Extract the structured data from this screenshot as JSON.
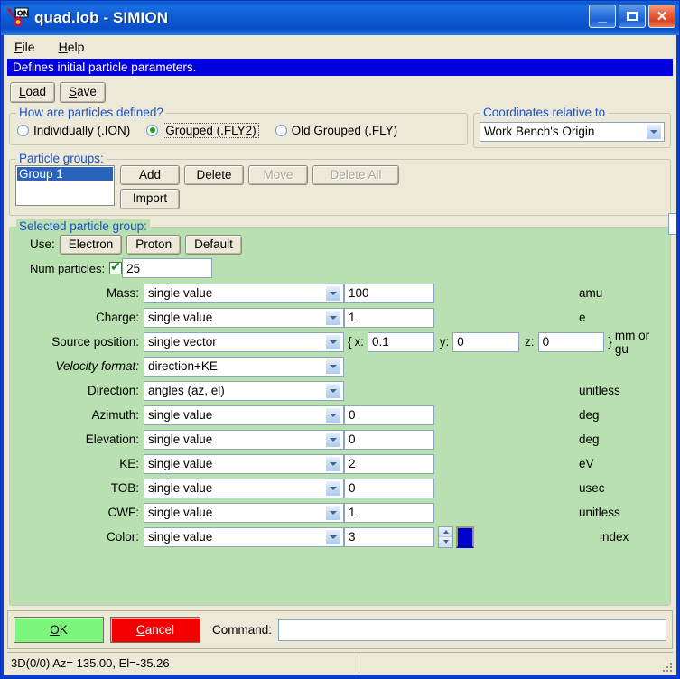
{
  "window": {
    "title": "quad.iob - SIMION",
    "app_icon": "ion-starburst-icon",
    "minimize": "_",
    "maximize": "maximize-icon",
    "close": "✕"
  },
  "menubar": {
    "items": [
      {
        "label": "File",
        "accel": "F"
      },
      {
        "label": "Help",
        "accel": "H"
      }
    ]
  },
  "hint": {
    "text": "Defines initial particle parameters."
  },
  "toolbar": {
    "load_label": "Load",
    "load_accel": "L",
    "save_label": "Save",
    "save_accel": "S"
  },
  "defined_group": {
    "title": "How are particles defined?",
    "options": [
      {
        "label": "Individually (.ION)",
        "selected": false,
        "focused": false
      },
      {
        "label": "Grouped (.FLY2)",
        "selected": true,
        "focused": true
      },
      {
        "label": "Old Grouped (.FLY)",
        "selected": false,
        "focused": false
      }
    ]
  },
  "coords_group": {
    "title": "Coordinates relative to",
    "value": "Work Bench's Origin"
  },
  "particle_groups": {
    "title": "Particle groups:",
    "list": [
      "Group 1"
    ],
    "selected": "Group 1",
    "buttons": [
      {
        "label": "Add",
        "enabled": true
      },
      {
        "label": "Delete",
        "enabled": true
      },
      {
        "label": "Move",
        "enabled": false
      },
      {
        "label": "Delete All",
        "enabled": false
      },
      {
        "label": "Import",
        "enabled": true
      }
    ]
  },
  "selected_group": {
    "title": "Selected particle group:",
    "use_label": "Use:",
    "use_buttons": [
      "Electron",
      "Proton",
      "Default"
    ],
    "num_particles_label": "Num particles:",
    "num_particles_checked": true,
    "num_particles_value": "25",
    "rows": [
      {
        "label": "Mass:",
        "italic": false,
        "mode": "single value",
        "value": "100",
        "unit": "amu"
      },
      {
        "label": "Charge:",
        "italic": false,
        "mode": "single value",
        "value": "1",
        "unit": "e"
      },
      {
        "label": "Source position:",
        "italic": false,
        "mode": "single vector",
        "vector": {
          "open": "{",
          "x_label": "x:",
          "x": "0.1",
          "y_label": "y:",
          "y": "0",
          "z_label": "z:",
          "z": "0",
          "close": "}"
        },
        "unit": "mm or gu"
      },
      {
        "label": "Velocity format:",
        "italic": true,
        "mode": "direction+KE",
        "value": null,
        "unit": ""
      },
      {
        "label": "Direction:",
        "italic": false,
        "mode": "angles (az, el)",
        "value": null,
        "unit": "unitless"
      },
      {
        "label": "Azimuth:",
        "italic": false,
        "mode": "single value",
        "value": "0",
        "unit": "deg"
      },
      {
        "label": "Elevation:",
        "italic": false,
        "mode": "single value",
        "value": "0",
        "unit": "deg"
      },
      {
        "label": "KE:",
        "italic": false,
        "mode": "single value",
        "value": "2",
        "unit": "eV"
      },
      {
        "label": "TOB:",
        "italic": false,
        "mode": "single value",
        "value": "0",
        "unit": "usec"
      },
      {
        "label": "CWF:",
        "italic": false,
        "mode": "single value",
        "value": "1",
        "unit": "unitless"
      },
      {
        "label": "Color:",
        "italic": false,
        "mode": "single value",
        "value": "3",
        "unit": "index",
        "spinner": true,
        "swatch_color": "#0000cc"
      }
    ]
  },
  "bottom": {
    "ok_label": "OK",
    "ok_accel": "O",
    "cancel_label": "Cancel",
    "cancel_accel": "C",
    "command_label": "Command:",
    "command_value": ""
  },
  "statusbar": {
    "left": "3D(0/0) Az= 135.00, El=-35.26",
    "right": ""
  },
  "colors": {
    "title_blue": "#0a57cf",
    "hint_blue": "#0000e0",
    "panel_green": "#b8e0b0",
    "group_label_blue": "#1a52c8",
    "ok_green": "#7cf77c",
    "cancel_red": "#f50000",
    "face": "#ece9d8"
  }
}
